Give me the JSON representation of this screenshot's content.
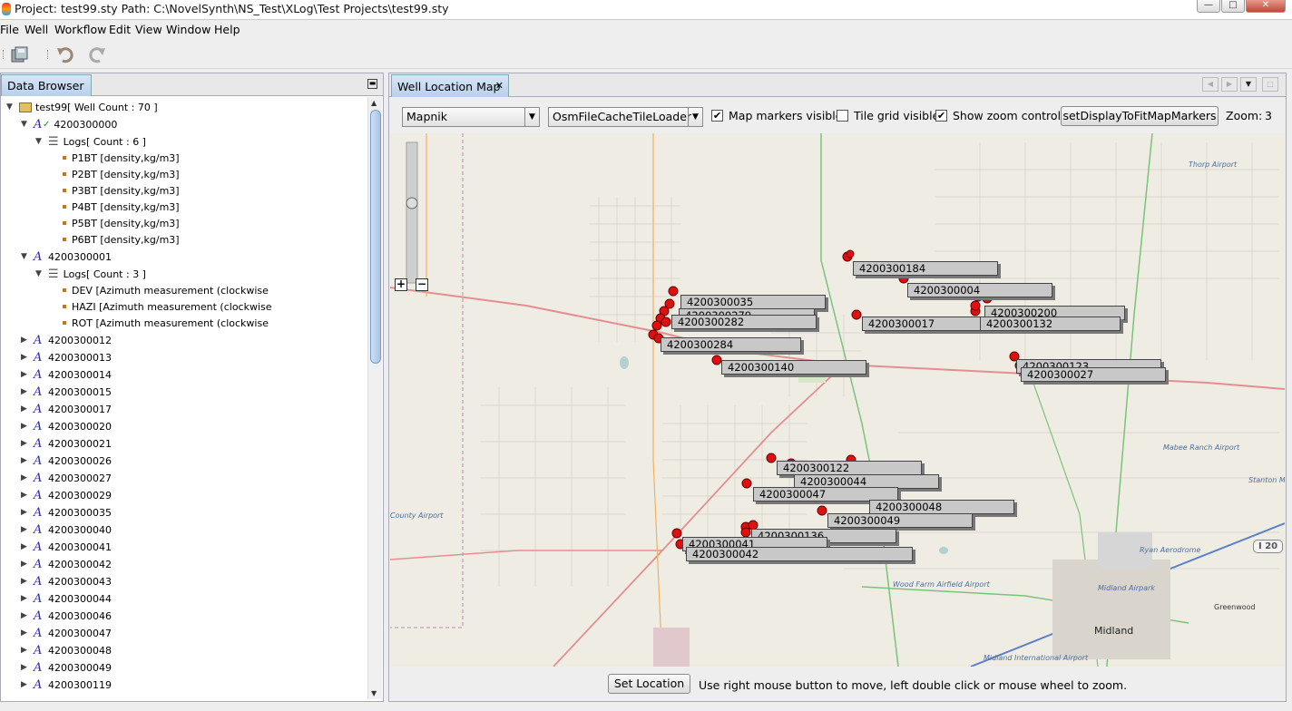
{
  "window": {
    "title": "Project: test99.sty Path: C:\\NovelSynth\\NS_Test\\XLog\\Test Projects\\test99.sty",
    "controls": [
      "—",
      "□",
      "✕"
    ]
  },
  "menu": [
    "File",
    "Well",
    "Workflow",
    "Edit",
    "View",
    "Window",
    "Help"
  ],
  "toolbar": {
    "save_icon": "save-icon",
    "undo_icon": "undo-icon",
    "redo_icon": "redo-icon"
  },
  "left_panel": {
    "tab_label": "Data Browser",
    "tree": {
      "root": "test99[ Well Count : 70 ]",
      "wells_expanded": [
        {
          "name": "4200300000",
          "logs_label": "Logs[ Count : 6 ]",
          "logs": [
            "P1BT [density,kg/m3]",
            "P2BT [density,kg/m3]",
            "P3BT [density,kg/m3]",
            "P4BT [density,kg/m3]",
            "P5BT [density,kg/m3]",
            "P6BT [density,kg/m3]"
          ]
        },
        {
          "name": "4200300001",
          "logs_label": "Logs[ Count : 3 ]",
          "logs": [
            "DEV  [Azimuth measurement (clockwise",
            "HAZI [Azimuth measurement (clockwise",
            "ROT  [Azimuth measurement (clockwise"
          ]
        }
      ],
      "wells_collapsed": [
        "4200300012",
        "4200300013",
        "4200300014",
        "4200300015",
        "4200300017",
        "4200300020",
        "4200300021",
        "4200300026",
        "4200300027",
        "4200300029",
        "4200300035",
        "4200300040",
        "4200300041",
        "4200300042",
        "4200300043",
        "4200300044",
        "4200300046",
        "4200300047",
        "4200300048",
        "4200300049",
        "4200300119"
      ]
    }
  },
  "right_panel": {
    "tab_label": "Well Location Map",
    "tile_source": "Mapnik",
    "tile_loader": "OsmFileCacheTileLoader",
    "map_markers_visible_label": "Map markers visible",
    "map_markers_visible": true,
    "tile_grid_visible_label": "Tile grid visible",
    "tile_grid_visible": false,
    "show_zoom_controls_label": "Show zoom controls",
    "show_zoom_controls": true,
    "fit_button_label": "setDisplayToFitMapMarkers",
    "zoom_label": "Zoom:",
    "zoom_value": "3",
    "set_location_label": "Set Location",
    "hint": "Use right mouse button to move, left double click or mouse wheel to zoom."
  },
  "map": {
    "marker_labels": [
      "4200300184",
      "4200300004",
      "4200300035",
      "4200300279",
      "4200300282",
      "4200300017",
      "4200300200",
      "4200300132",
      "4200300284",
      "4200300140",
      "4200300123",
      "4200300027",
      "4200300122",
      "4200300044",
      "4200300047",
      "4200300048",
      "4200300049",
      "4200300136",
      "4200300041",
      "4200300042"
    ],
    "place_names": [
      "Thorp Airport",
      "Mabee Ranch Airport",
      "Stanton Mun",
      "County Airport",
      "Ryan Aerodrome",
      "Wood Farm Airfield Airport",
      "Midland Airpark",
      "Greenwood",
      "Midland",
      "Midland International Airport"
    ],
    "highway_shield": "I 20"
  }
}
